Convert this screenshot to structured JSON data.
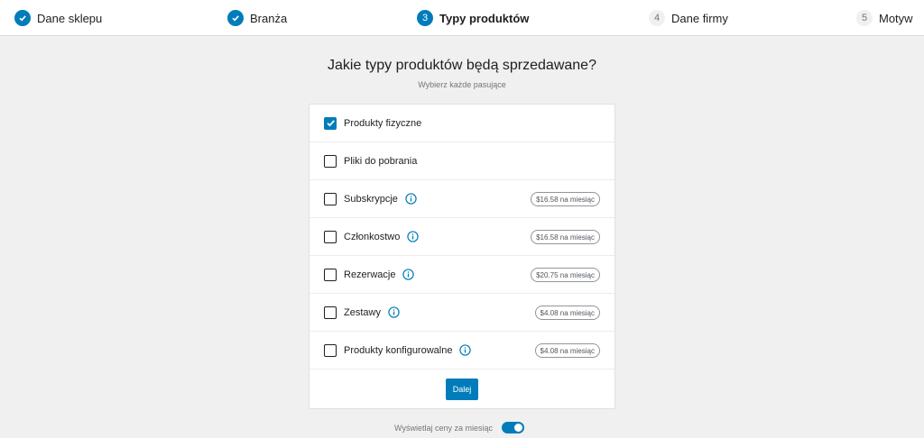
{
  "stepper": {
    "steps": [
      {
        "number": "1",
        "label": "Dane sklepu",
        "state": "done"
      },
      {
        "number": "2",
        "label": "Branża",
        "state": "done"
      },
      {
        "number": "3",
        "label": "Typy produktów",
        "state": "active"
      },
      {
        "number": "4",
        "label": "Dane firmy",
        "state": "todo"
      },
      {
        "number": "5",
        "label": "Motyw",
        "state": "todo"
      }
    ]
  },
  "page": {
    "title": "Jakie typy produktów będą sprzedawane?",
    "subtitle": "Wybierz każde pasujące"
  },
  "product_types": [
    {
      "label": "Produkty fizyczne",
      "checked": true,
      "has_info": false,
      "price": ""
    },
    {
      "label": "Pliki do pobrania",
      "checked": false,
      "has_info": false,
      "price": ""
    },
    {
      "label": "Subskrypcje",
      "checked": false,
      "has_info": true,
      "price": "$16.58 na miesiąc"
    },
    {
      "label": "Członkostwo",
      "checked": false,
      "has_info": true,
      "price": "$16.58 na miesiąc"
    },
    {
      "label": "Rezerwacje",
      "checked": false,
      "has_info": true,
      "price": "$20.75 na miesiąc"
    },
    {
      "label": "Zestawy",
      "checked": false,
      "has_info": true,
      "price": "$4.08 na miesiąc"
    },
    {
      "label": "Produkty konfigurowalne",
      "checked": false,
      "has_info": true,
      "price": "$4.08 na miesiąc"
    }
  ],
  "actions": {
    "next_label": "Dalej"
  },
  "monthly_toggle": {
    "label": "Wyświetlaj ceny za miesiąc",
    "enabled": true
  },
  "colors": {
    "accent": "#007cba",
    "background": "#f0f0f1"
  }
}
